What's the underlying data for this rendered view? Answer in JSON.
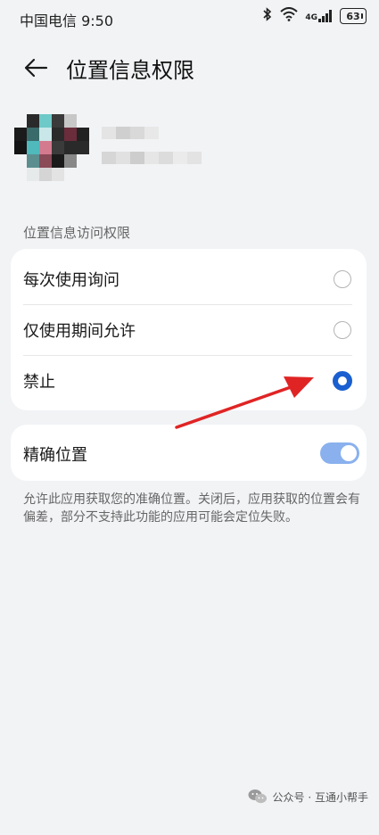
{
  "status_bar": {
    "carrier_time": "中国电信 9:50",
    "network_label": "4G",
    "battery": "63"
  },
  "header": {
    "title": "位置信息权限"
  },
  "location_access": {
    "section_label": "位置信息访问权限",
    "options": [
      {
        "label": "每次使用询问",
        "selected": false
      },
      {
        "label": "仅使用期间允许",
        "selected": false
      },
      {
        "label": "禁止",
        "selected": true
      }
    ]
  },
  "precise_location": {
    "label": "精确位置",
    "enabled": true,
    "description": "允许此应用获取您的准确位置。关闭后，应用获取的位置会有偏差，部分不支持此功能的应用可能会定位失败。"
  },
  "watermark": {
    "text": "公众号 · 互通小帮手"
  },
  "colors": {
    "accent": "#1a5fd0",
    "annotation_arrow": "#e02424",
    "toggle_on": "#8ab1ee"
  }
}
